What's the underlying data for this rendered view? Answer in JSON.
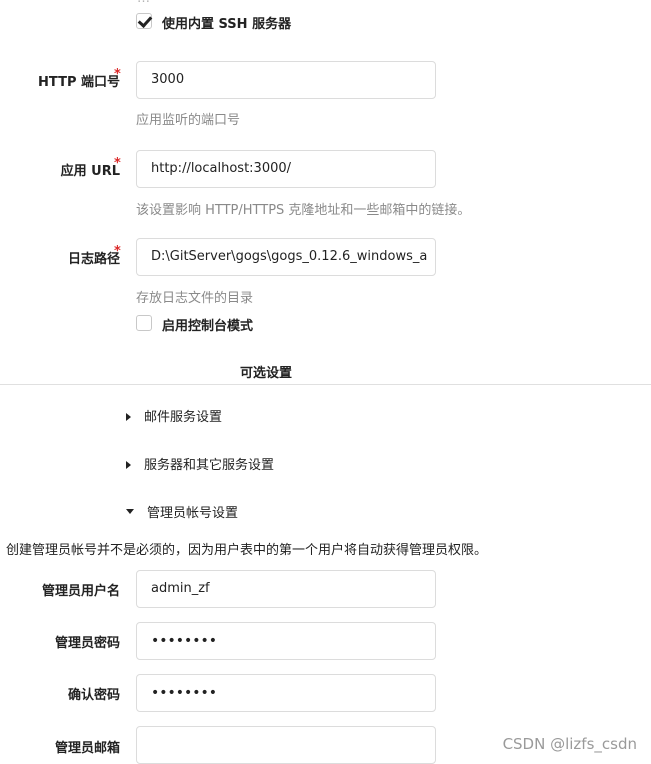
{
  "top_cut_text": "…",
  "builtin_ssh": {
    "label": "使用内置 SSH 服务器",
    "checked": true
  },
  "http_port": {
    "label": "HTTP 端口号",
    "value": "3000",
    "help": "应用监听的端口号"
  },
  "app_url": {
    "label": "应用 URL",
    "value": "http://localhost:3000/",
    "help": "该设置影响 HTTP/HTTPS 克隆地址和一些邮箱中的链接。"
  },
  "log_path": {
    "label": "日志路径",
    "value": "D:\\GitServer\\gogs\\gogs_0.12.6_windows_a",
    "help": "存放日志文件的目录"
  },
  "console_mode": {
    "label": "启用控制台模式",
    "checked": false
  },
  "optional_settings": {
    "title": "可选设置",
    "mail_settings": "邮件服务设置",
    "server_settings": "服务器和其它服务设置",
    "admin_settings": "管理员帐号设置"
  },
  "admin": {
    "note": "创建管理员帐号并不是必须的，因为用户表中的第一个用户将自动获得管理员权限。",
    "username_label": "管理员用户名",
    "username_value": "admin_zf",
    "password_label": "管理员密码",
    "password_value": "••••••••",
    "confirm_label": "确认密码",
    "confirm_value": "••••••••",
    "email_label": "管理员邮箱",
    "email_value": ""
  },
  "watermark": "CSDN @lizfs_csdn"
}
